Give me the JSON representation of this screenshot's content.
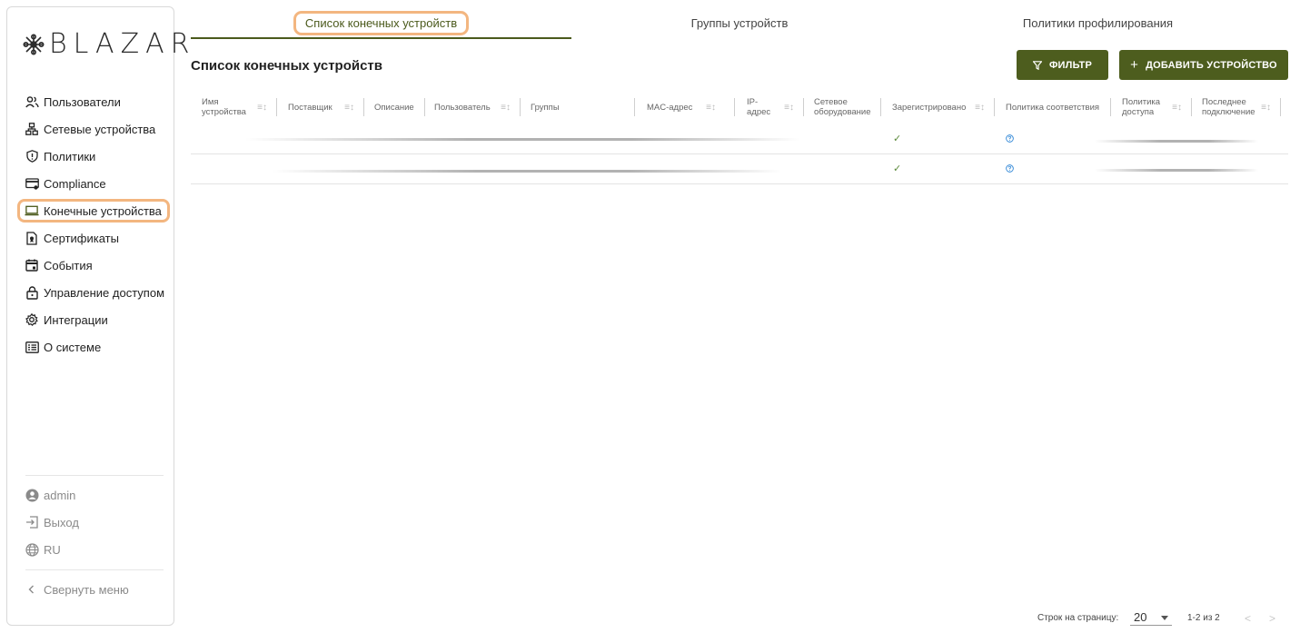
{
  "app": {
    "logo_text": "BLAZAR"
  },
  "sidebar": {
    "items": [
      {
        "label": "Пользователи",
        "icon": "users-icon"
      },
      {
        "label": "Сетевые устройства",
        "icon": "network-icon"
      },
      {
        "label": "Политики",
        "icon": "shield-icon"
      },
      {
        "label": "Compliance",
        "icon": "card-check-icon"
      },
      {
        "label": "Конечные устройства",
        "icon": "laptop-icon",
        "active": true
      },
      {
        "label": "Сертификаты",
        "icon": "certificate-icon"
      },
      {
        "label": "События",
        "icon": "calendar-icon"
      },
      {
        "label": "Управление доступом",
        "icon": "lock-icon"
      },
      {
        "label": "Интеграции",
        "icon": "gear-icon"
      },
      {
        "label": "О системе",
        "icon": "info-box-icon"
      }
    ],
    "bottom": {
      "user": "admin",
      "logout": "Выход",
      "language": "RU",
      "collapse": "Свернуть меню"
    }
  },
  "tabs": [
    {
      "label": "Список конечных устройств",
      "active": true
    },
    {
      "label": "Группы устройств"
    },
    {
      "label": "Политики профилирования"
    }
  ],
  "page": {
    "title": "Список конечных устройств",
    "filter_button": "ФИЛЬТР",
    "add_button": "ДОБАВИТЬ УСТРОЙСТВО"
  },
  "table": {
    "columns": [
      "Имя устройства",
      "Поставщик",
      "Описание",
      "Пользователь",
      "Группы",
      "MAC-адрес",
      "IP-адрес",
      "Сетевое оборудование",
      "Зарегистрировано",
      "Политика соответствия",
      "Политика доступа",
      "Последнее подключение"
    ],
    "rows": [
      {
        "registered": "✓",
        "compliance": "question-icon"
      },
      {
        "registered": "✓",
        "compliance": "question-icon"
      }
    ]
  },
  "pagination": {
    "rows_per_page_label": "Строк на страницу:",
    "rows_per_page": "20",
    "range": "1-2 из 2"
  },
  "colors": {
    "accent": "#4d5d1e",
    "highlight": "#f3b680",
    "info": "#2f86d6"
  }
}
